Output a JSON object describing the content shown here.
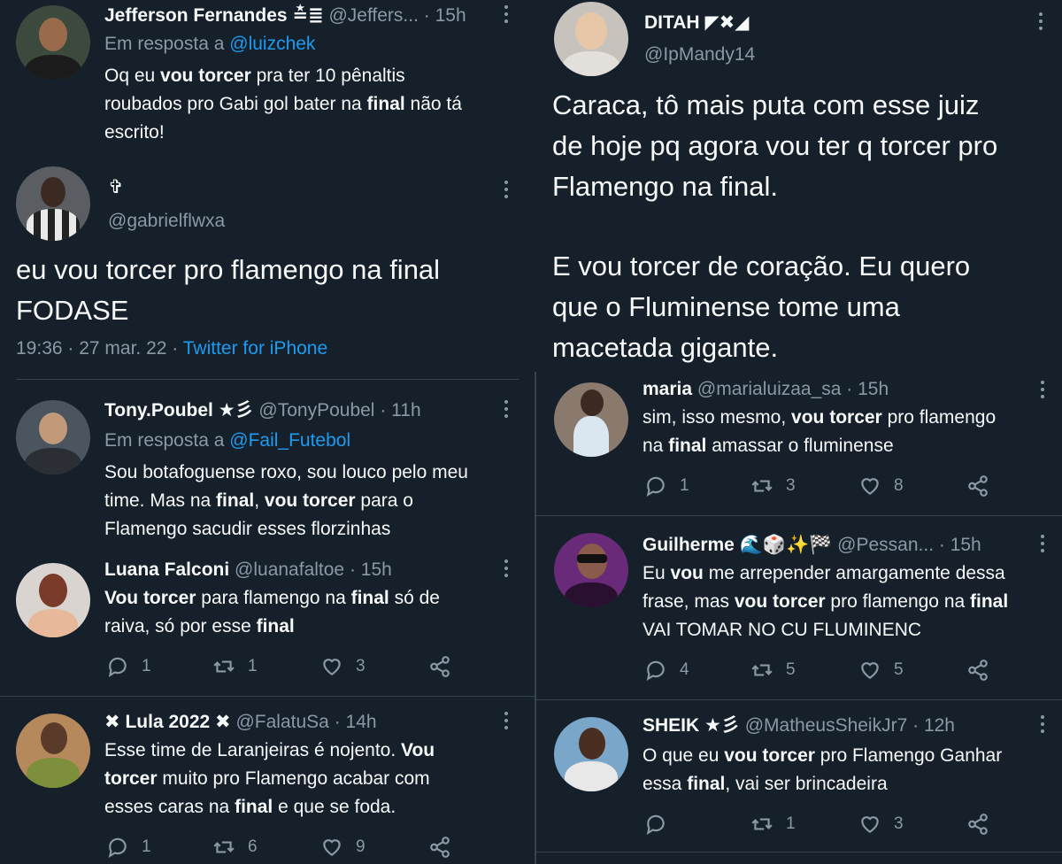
{
  "left": {
    "t1": {
      "name": "Jefferson Fernandes",
      "name_emoji": "≛≣",
      "handle": "@Jeffers...",
      "time": "· 15h",
      "reply_prefix": "Em resposta a",
      "reply_to": "@luizchek",
      "line1": [
        "Oq eu ",
        "vou torcer",
        " pra ter 10 pênaltis"
      ],
      "line2": [
        "roubados pro Gabi gol bater na ",
        "final",
        " não tá"
      ],
      "line3": "escrito!"
    },
    "t2": {
      "name": "✞",
      "handle": "@gabrielflwxa",
      "text1": "eu vou torcer pro flamengo na final",
      "text2": "FODASE",
      "meta_time": "19:36 · 27 mar. 22 ·",
      "meta_client": "Twitter for iPhone"
    },
    "t3": {
      "name": "Tony.Poubel",
      "name_emoji": "★彡",
      "handle": "@TonyPoubel",
      "time": "· 11h",
      "reply_prefix": "Em resposta a",
      "reply_to": "@Fail_Futebol",
      "line1": "Sou botafoguense roxo, sou louco pelo meu",
      "line2": [
        "time. Mas na ",
        "final",
        ", ",
        "vou torcer",
        " para o"
      ],
      "line3": "Flamengo sacudir esses florzinhas"
    },
    "t4": {
      "name": "Luana Falconi",
      "handle": "@luanafaltoe",
      "time": "· 15h",
      "line1": [
        "Vou torcer",
        " para flamengo na ",
        "final",
        " só de"
      ],
      "line2": [
        "raiva, só por esse ",
        "final"
      ],
      "replies": "1",
      "retweets": "1",
      "likes": "3"
    },
    "t5": {
      "name_prefix": "✖",
      "name": "Lula 2022",
      "name_emoji": "✖",
      "handle": "@FalatuSa",
      "time": "· 14h",
      "line1": [
        "Esse time de Laranjeiras é nojento. ",
        "Vou"
      ],
      "line2": [
        "torcer",
        " muito pro Flamengo acabar com"
      ],
      "line3": [
        "esses caras na ",
        "final",
        " e que se foda."
      ],
      "replies": "1",
      "retweets": "6",
      "likes": "9"
    }
  },
  "right": {
    "t1": {
      "name": "DITAH",
      "name_emoji": "◤✖◢",
      "handle": "@IpMandy14",
      "lines": [
        "Caraca, tô mais puta com esse juiz",
        "de hoje pq agora vou ter q torcer pro",
        "Flamengo na final.",
        "E vou torcer de coração. Eu quero",
        "que o Fluminense tome uma",
        "macetada gigante."
      ]
    },
    "t2": {
      "name": "maria",
      "handle": "@marialuizaa_sa",
      "time": "· 15h",
      "line1": [
        "sim, isso mesmo, ",
        "vou torcer",
        " pro flamengo"
      ],
      "line2": [
        "na ",
        "final",
        " amassar o fluminense"
      ],
      "replies": "1",
      "retweets": "3",
      "likes": "8"
    },
    "t3": {
      "name": "Guilherme",
      "name_emoji": "🌊🎲✨🏁",
      "handle": "@Pessan...",
      "time": "· 15h",
      "line1": [
        "Eu ",
        "vou",
        " me arrepender amargamente dessa"
      ],
      "line2": [
        "frase, mas ",
        "vou torcer",
        " pro flamengo na ",
        "final"
      ],
      "line3": "VAI TOMAR NO CU FLUMINENC",
      "replies": "4",
      "retweets": "5",
      "likes": "5"
    },
    "t4": {
      "name": "SHEIK",
      "name_emoji": "★彡",
      "handle": "@MatheusSheikJr7",
      "time": "· 12h",
      "line1": [
        "O que eu ",
        "vou torcer",
        " pro Flamengo Ganhar"
      ],
      "line2": [
        "essa ",
        "final",
        ", vai ser brincadeira"
      ],
      "replies": "",
      "retweets": "1",
      "likes": "3"
    }
  },
  "colors": {
    "background": "#15202b",
    "text": "#f7f9f9",
    "muted": "#8b98a5",
    "link": "#1d9bf0",
    "divider": "#38444d"
  }
}
